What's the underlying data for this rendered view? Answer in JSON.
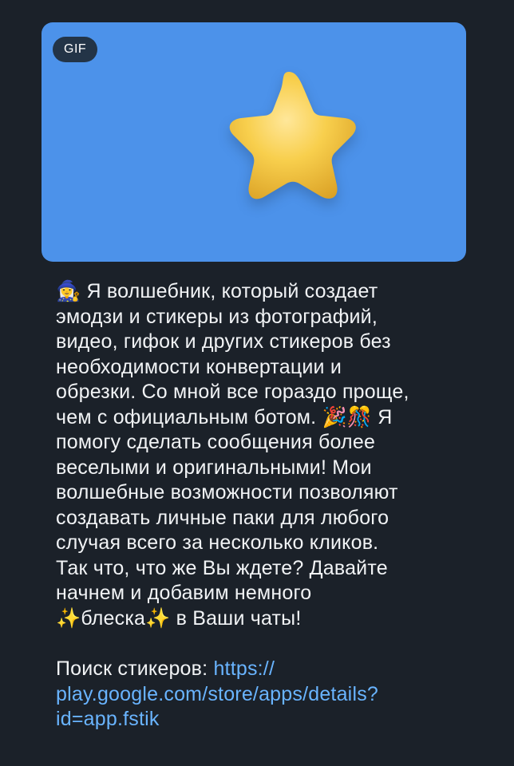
{
  "message": {
    "media": {
      "badge": "GIF",
      "image": "star-icon",
      "background_color": "#4c92ea"
    },
    "text_lines": [
      "🧙‍♀️ Я волшебник, который создает",
      "эмодзи и стикеры из фотографий,",
      "видео, гифок и других стикеров без",
      "необходимости конвертации и",
      "обрезки. Со мной все гораздо проще,",
      "чем с официальным ботом. 🎉🎊 Я",
      "помогу сделать сообщения более",
      "веселыми и оригинальными! Мои",
      "волшебные возможности позволяют",
      "создавать личные паки для любого",
      "случая всего за несколько кликов.",
      "Так что, что же Вы ждете? Давайте",
      "начнем и добавим немного",
      "✨блеска✨ в Ваши чаты!"
    ],
    "search_label": "Поиск стикеров: ",
    "link_lines": [
      "https://",
      "play.google.com/store/apps/details?",
      "id=app.fstik"
    ],
    "colors": {
      "background": "#1b2129",
      "text": "#f1f3f5",
      "link": "#69b4ff",
      "badge_bg": "#233447"
    }
  }
}
